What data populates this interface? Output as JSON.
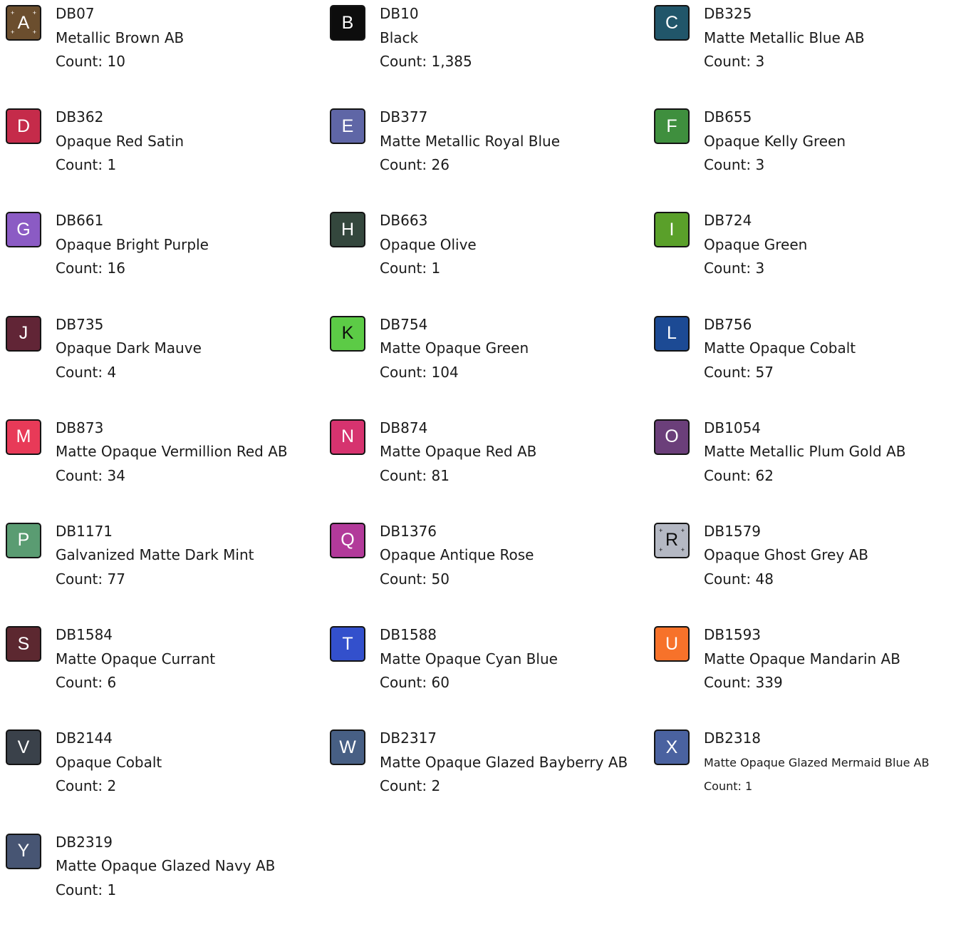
{
  "beads": [
    {
      "letter": "A",
      "code": "DB07",
      "name": "Metallic Brown AB",
      "count": "Count: 10",
      "color": "#6b4e2e",
      "text_color": "#ffffff",
      "sparkle": true
    },
    {
      "letter": "B",
      "code": "DB10",
      "name": "Black",
      "count": "Count: 1,385",
      "color": "#0d0d0d",
      "text_color": "#ffffff",
      "sparkle": false
    },
    {
      "letter": "C",
      "code": "DB325",
      "name": "Matte Metallic Blue AB",
      "count": "Count: 3",
      "color": "#21566a",
      "text_color": "#ffffff",
      "sparkle": false
    },
    {
      "letter": "D",
      "code": "DB362",
      "name": "Opaque Red Satin",
      "count": "Count: 1",
      "color": "#c52b4a",
      "text_color": "#ffffff",
      "sparkle": false
    },
    {
      "letter": "E",
      "code": "DB377",
      "name": "Matte Metallic Royal Blue",
      "count": "Count: 26",
      "color": "#5f66a6",
      "text_color": "#ffffff",
      "sparkle": false
    },
    {
      "letter": "F",
      "code": "DB655",
      "name": "Opaque Kelly Green",
      "count": "Count: 3",
      "color": "#3f8f3e",
      "text_color": "#ffffff",
      "sparkle": false
    },
    {
      "letter": "G",
      "code": "DB661",
      "name": "Opaque Bright Purple",
      "count": "Count: 16",
      "color": "#8b5bc4",
      "text_color": "#ffffff",
      "sparkle": false
    },
    {
      "letter": "H",
      "code": "DB663",
      "name": "Opaque Olive",
      "count": "Count: 1",
      "color": "#34473d",
      "text_color": "#ffffff",
      "sparkle": false
    },
    {
      "letter": "I",
      "code": "DB724",
      "name": "Opaque Green",
      "count": "Count: 3",
      "color": "#5aa02a",
      "text_color": "#ffffff",
      "sparkle": false
    },
    {
      "letter": "J",
      "code": "DB735",
      "name": "Opaque Dark Mauve",
      "count": "Count: 4",
      "color": "#612536",
      "text_color": "#ffffff",
      "sparkle": false
    },
    {
      "letter": "K",
      "code": "DB754",
      "name": "Matte Opaque Green",
      "count": "Count: 104",
      "color": "#5ccb46",
      "text_color": "#0d0d0d",
      "sparkle": false
    },
    {
      "letter": "L",
      "code": "DB756",
      "name": "Matte Opaque Cobalt",
      "count": "Count: 57",
      "color": "#1c4a94",
      "text_color": "#ffffff",
      "sparkle": false
    },
    {
      "letter": "M",
      "code": "DB873",
      "name": "Matte Opaque Vermillion Red AB",
      "count": "Count: 34",
      "color": "#e83a58",
      "text_color": "#ffffff",
      "sparkle": false
    },
    {
      "letter": "N",
      "code": "DB874",
      "name": "Matte Opaque Red AB",
      "count": "Count: 81",
      "color": "#d6336f",
      "text_color": "#ffffff",
      "sparkle": false
    },
    {
      "letter": "O",
      "code": "DB1054",
      "name": "Matte Metallic Plum Gold AB",
      "count": "Count: 62",
      "color": "#6b3f7a",
      "text_color": "#ffffff",
      "sparkle": false
    },
    {
      "letter": "P",
      "code": "DB1171",
      "name": "Galvanized Matte Dark Mint",
      "count": "Count: 77",
      "color": "#5a9c72",
      "text_color": "#ffffff",
      "sparkle": false
    },
    {
      "letter": "Q",
      "code": "DB1376",
      "name": "Opaque Antique Rose",
      "count": "Count: 50",
      "color": "#b23a9a",
      "text_color": "#ffffff",
      "sparkle": false
    },
    {
      "letter": "R",
      "code": "DB1579",
      "name": "Opaque Ghost Grey AB",
      "count": "Count: 48",
      "color": "#b4b8c3",
      "text_color": "#0d0d0d",
      "sparkle": true
    },
    {
      "letter": "S",
      "code": "DB1584",
      "name": "Matte Opaque Currant",
      "count": "Count: 6",
      "color": "#5c2830",
      "text_color": "#ffffff",
      "sparkle": false
    },
    {
      "letter": "T",
      "code": "DB1588",
      "name": "Matte Opaque Cyan Blue",
      "count": "Count: 60",
      "color": "#3350cc",
      "text_color": "#ffffff",
      "sparkle": false
    },
    {
      "letter": "U",
      "code": "DB1593",
      "name": "Matte Opaque Mandarin AB",
      "count": "Count: 339",
      "color": "#f7722a",
      "text_color": "#ffffff",
      "sparkle": false
    },
    {
      "letter": "V",
      "code": "DB2144",
      "name": "Opaque Cobalt",
      "count": "Count: 2",
      "color": "#3a414a",
      "text_color": "#ffffff",
      "sparkle": false
    },
    {
      "letter": "W",
      "code": "DB2317",
      "name": "Matte Opaque Glazed Bayberry AB",
      "count": "Count: 2",
      "color": "#475f84",
      "text_color": "#ffffff",
      "sparkle": false
    },
    {
      "letter": "X",
      "code": "DB2318",
      "name": "Matte Opaque Glazed Mermaid Blue AB",
      "count": "Count: 1",
      "color": "#4a62a0",
      "text_color": "#ffffff",
      "sparkle": false,
      "small": true
    },
    {
      "letter": "Y",
      "code": "DB2319",
      "name": "Matte Opaque Glazed Navy AB",
      "count": "Count: 1",
      "color": "#475573",
      "text_color": "#ffffff",
      "sparkle": false
    }
  ]
}
